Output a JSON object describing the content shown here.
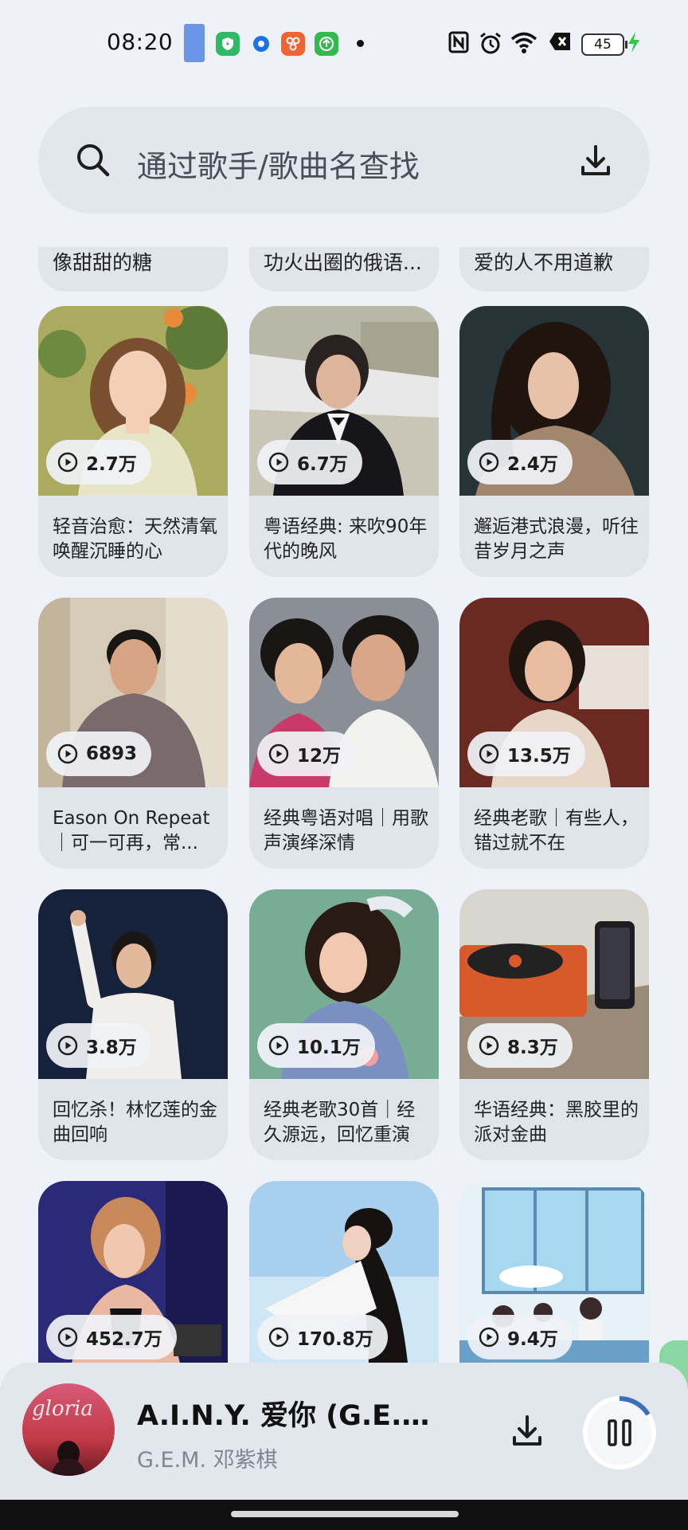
{
  "status_bar": {
    "time": "08:20",
    "battery": "45",
    "icons": [
      "shield-app-icon",
      "messenger-app-icon",
      "orange-app-icon",
      "upload-app-icon",
      "nfc-icon",
      "alarm-icon",
      "wifi-icon",
      "sim-off-icon",
      "charging-icon"
    ]
  },
  "search": {
    "placeholder": "通过歌手/歌曲名查找"
  },
  "top_row": [
    {
      "title": "像甜甜的糖"
    },
    {
      "title": "功火出圈的俄语..."
    },
    {
      "title": "爱的人不用道歉"
    }
  ],
  "playlists": [
    {
      "plays": "2.7万",
      "title": "轻音治愈：天然清氧唤醒沉睡的心"
    },
    {
      "plays": "6.7万",
      "title": "粤语经典: 来吹90年代的晚风"
    },
    {
      "plays": "2.4万",
      "title": "邂逅港式浪漫，听往昔岁月之声"
    },
    {
      "plays": "6893",
      "title": "Eason On Repeat｜可一可再，常..."
    },
    {
      "plays": "12万",
      "title": "经典粤语对唱｜用歌声演绎深情"
    },
    {
      "plays": "13.5万",
      "title": "经典老歌｜有些人，错过就不在"
    },
    {
      "plays": "3.8万",
      "title": "回忆杀！林忆莲的金曲回响"
    },
    {
      "plays": "10.1万",
      "title": "经典老歌30首｜经久源远，回忆重演"
    },
    {
      "plays": "8.3万",
      "title": "华语经典：黑胶里的派对金曲"
    },
    {
      "plays": "452.7万",
      "title": ""
    },
    {
      "plays": "170.8万",
      "title": ""
    },
    {
      "plays": "9.4万",
      "title": ""
    }
  ],
  "player": {
    "title": "A.I.N.Y. 爱你 (G.E.M....",
    "artist": "G.E.M. 邓紫棋",
    "album_text": "gloria"
  },
  "colors": {
    "background": "#eef2f8",
    "card": "#e0e5ec",
    "accent": "#3b6fb6"
  }
}
